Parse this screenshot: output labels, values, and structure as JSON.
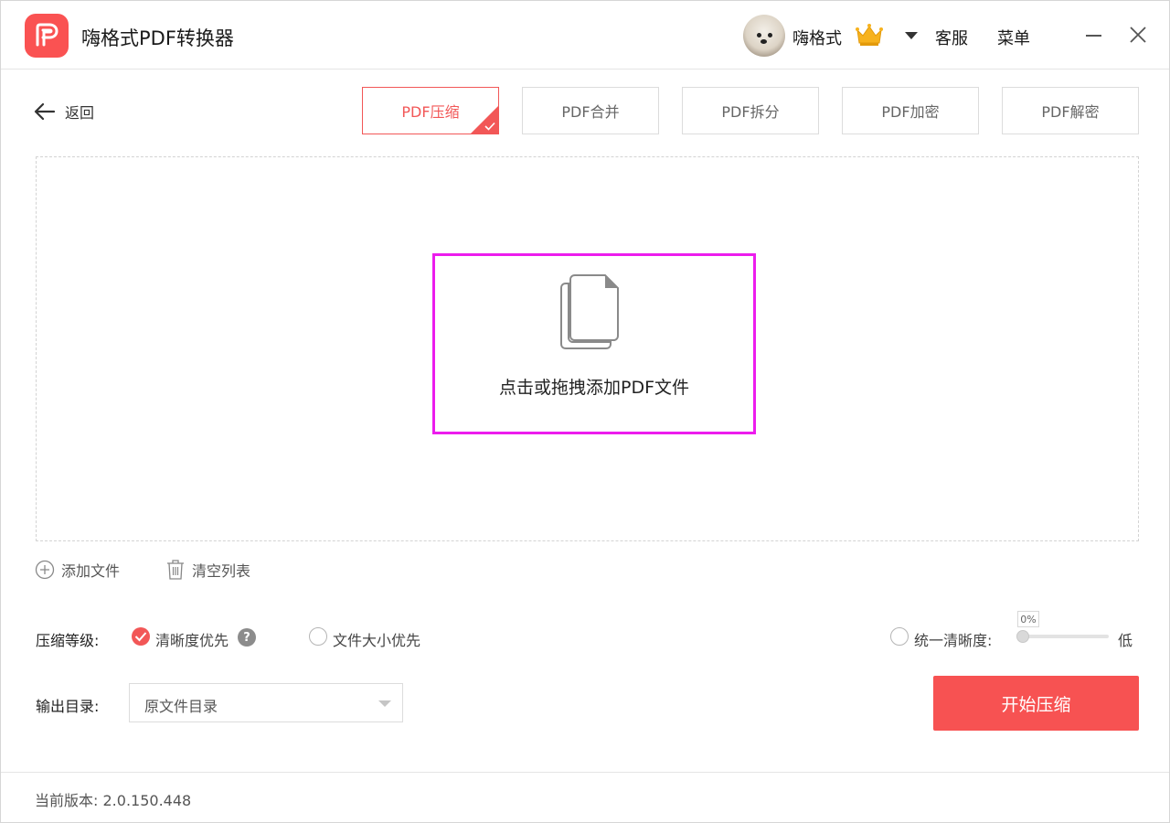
{
  "app": {
    "title": "嗨格式PDF转换器",
    "brand_color": "#f25757"
  },
  "header": {
    "username": "嗨格式",
    "avatar_icon": "dog-avatar",
    "vip_icon": "crown-icon",
    "service_label": "客服",
    "menu_label": "菜单"
  },
  "toolbar": {
    "back_label": "返回",
    "tabs": [
      {
        "label": "PDF压缩",
        "active": true
      },
      {
        "label": "PDF合并",
        "active": false
      },
      {
        "label": "PDF拆分",
        "active": false
      },
      {
        "label": "PDF加密",
        "active": false
      },
      {
        "label": "PDF解密",
        "active": false
      }
    ]
  },
  "dropzone": {
    "prompt": "点击或拖拽添加PDF文件",
    "highlight_color": "#ec1ced"
  },
  "list_actions": {
    "add_files": "添加文件",
    "clear_list": "清空列表"
  },
  "compression": {
    "label": "压缩等级:",
    "option_clarity": "清晰度优先",
    "option_size": "文件大小优先",
    "selected": "清晰度优先",
    "help": "?",
    "uniform_label": "统一清晰度:",
    "slider_value_text": "0%",
    "slider_value": 0,
    "slider_end_label": "低"
  },
  "output": {
    "label": "输出目录:",
    "selected": "原文件目录"
  },
  "actions": {
    "start": "开始压缩"
  },
  "footer": {
    "version_label": "当前版本:",
    "version": "2.0.150.448"
  }
}
